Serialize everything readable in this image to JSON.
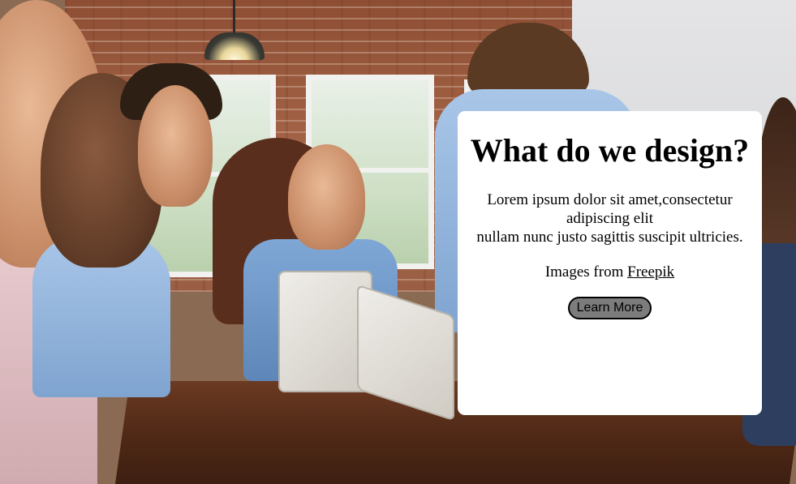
{
  "card": {
    "title": "What do we design?",
    "description_line1": "Lorem ipsum dolor sit amet,consectetur adipiscing elit",
    "description_line2": "nullam nunc justo sagittis suscipit ultricies.",
    "credit_prefix": "Images from ",
    "credit_link": "Freepik",
    "button_label": "Learn More"
  },
  "colors": {
    "card_background": "#ffffff",
    "button_background": "#7c7c7c",
    "text": "#000000"
  }
}
